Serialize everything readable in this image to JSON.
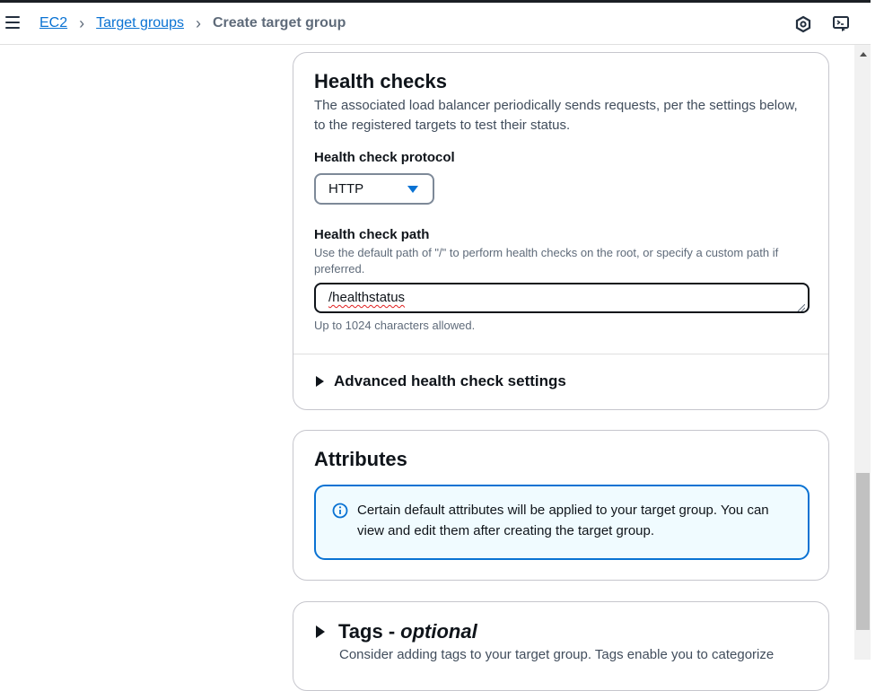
{
  "breadcrumb": {
    "items": [
      "EC2",
      "Target groups"
    ],
    "current": "Create target group"
  },
  "icons": {
    "menu": "hamburger-menu-icon",
    "settings": "hexagon-settings-icon",
    "cloudshell": "terminal-screen-icon",
    "info": "info-circle-icon"
  },
  "health_checks": {
    "title": "Health checks",
    "description": "The associated load balancer periodically sends requests, per the settings below, to the registered targets to test their status.",
    "protocol_label": "Health check protocol",
    "protocol_value": "HTTP",
    "path_label": "Health check path",
    "path_hint": "Use the default path of \"/\" to perform health checks on the root, or specify a custom path if preferred.",
    "path_value": "/healthstatus",
    "path_constraint": "Up to 1024 characters allowed.",
    "advanced_label": "Advanced health check settings"
  },
  "attributes": {
    "title": "Attributes",
    "info_text": "Certain default attributes will be applied to your target group. You can view and edit them after creating the target group."
  },
  "tags": {
    "title": "Tags -",
    "optional": "optional",
    "description": "Consider adding tags to your target group. Tags enable you to categorize"
  },
  "colors": {
    "link": "#0972d3",
    "info_border": "#0972d3",
    "info_bg": "#f0fbff",
    "text": "#0f141a",
    "muted": "#5f6b7a"
  }
}
